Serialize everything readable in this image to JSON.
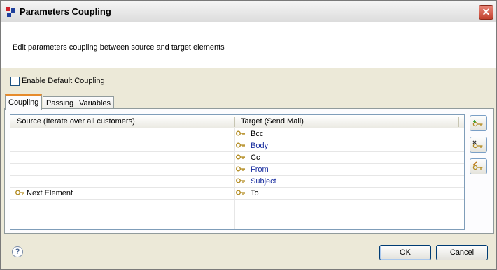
{
  "window": {
    "title": "Parameters Coupling",
    "close_label": "✕"
  },
  "header": {
    "message": "Edit parameters coupling between source and target elements"
  },
  "options": {
    "enable_default_coupling_label": "Enable Default Coupling",
    "enable_default_coupling_checked": false
  },
  "tabs": [
    {
      "label": "Coupling",
      "active": true
    },
    {
      "label": "Passing",
      "active": false
    },
    {
      "label": "Variables",
      "active": false
    }
  ],
  "table": {
    "columns": [
      "Source (Iterate over all customers)",
      "Target (Send Mail)"
    ],
    "rows": [
      {
        "source": "",
        "target": "Bcc",
        "target_color": "#000000"
      },
      {
        "source": "",
        "target": "Body",
        "target_color": "#1a2fa0"
      },
      {
        "source": "",
        "target": "Cc",
        "target_color": "#000000"
      },
      {
        "source": "",
        "target": "From",
        "target_color": "#1a2fa0"
      },
      {
        "source": "",
        "target": "Subject",
        "target_color": "#1a2fa0"
      },
      {
        "source": "Next Element",
        "target": "To",
        "target_color": "#000000"
      }
    ]
  },
  "side_buttons": [
    "add-coupling-icon",
    "remove-coupling-icon",
    "edit-coupling-icon"
  ],
  "footer": {
    "help_label": "?",
    "ok_label": "OK",
    "cancel_label": "Cancel"
  },
  "colors": {
    "accent_tab": "#e68b2c",
    "link": "#1a2fa0"
  }
}
